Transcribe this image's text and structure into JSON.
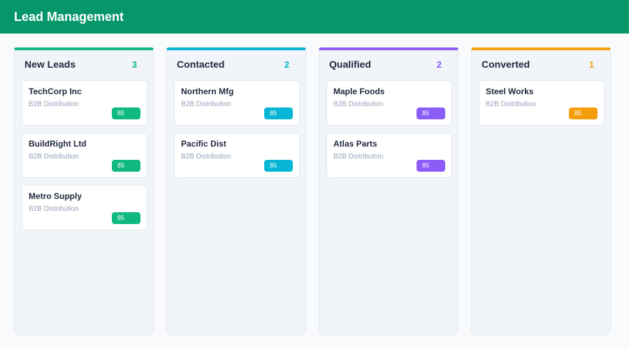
{
  "header": {
    "title": "Lead Management",
    "color": "#059669"
  },
  "columns": [
    {
      "title": "New Leads",
      "count": "3",
      "accent": "#10b981",
      "cards": [
        {
          "name": "TechCorp Inc",
          "type": "B2B Distribution",
          "score": "85"
        },
        {
          "name": "BuildRight Ltd",
          "type": "B2B Distribution",
          "score": "85"
        },
        {
          "name": "Metro Supply",
          "type": "B2B Distribution",
          "score": "85"
        }
      ]
    },
    {
      "title": "Contacted",
      "count": "2",
      "accent": "#06b6d4",
      "cards": [
        {
          "name": "Northern Mfg",
          "type": "B2B Distribution",
          "score": "85"
        },
        {
          "name": "Pacific Dist",
          "type": "B2B Distribution",
          "score": "85"
        }
      ]
    },
    {
      "title": "Qualified",
      "count": "2",
      "accent": "#8b5cf6",
      "cards": [
        {
          "name": "Maple Foods",
          "type": "B2B Distribution",
          "score": "85"
        },
        {
          "name": "Atlas Parts",
          "type": "B2B Distribution",
          "score": "85"
        }
      ]
    },
    {
      "title": "Converted",
      "count": "1",
      "accent": "#f59e0b",
      "cards": [
        {
          "name": "Steel Works",
          "type": "B2B Distribution",
          "score": "85"
        }
      ]
    }
  ]
}
